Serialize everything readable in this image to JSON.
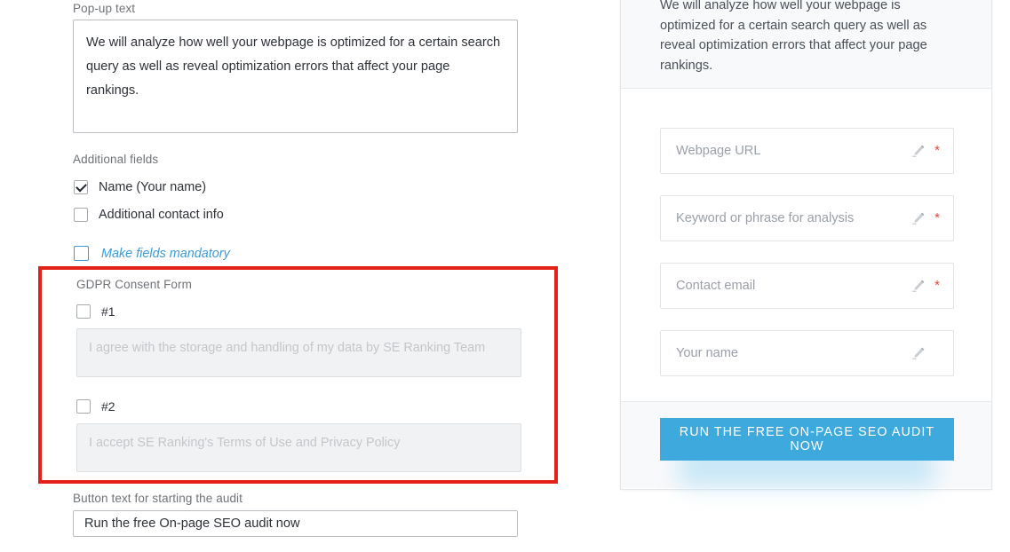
{
  "editor": {
    "popup_text": {
      "label": "Pop-up text",
      "value": "We will analyze how well your webpage is optimized for a certain search query as well as reveal optimization errors that affect your page rankings."
    },
    "additional_fields": {
      "label": "Additional fields",
      "items": [
        {
          "label": "Name (Your name)",
          "checked": true
        },
        {
          "label": "Additional contact info",
          "checked": false
        }
      ],
      "mandatory_toggle": {
        "label": "Make fields mandatory",
        "checked": false
      }
    },
    "gdpr": {
      "label": "GDPR Consent Form",
      "highlight_color": "#e32119",
      "consents": [
        {
          "number": "#1",
          "checked": false,
          "text": "I agree with the storage and handling of my data by SE Ranking Team"
        },
        {
          "number": "#2",
          "checked": false,
          "text": "I accept SE Ranking's Terms of Use and Privacy Policy"
        }
      ]
    },
    "button_text": {
      "label": "Button text for starting the audit",
      "value": "Run the free On-page SEO audit now"
    }
  },
  "preview": {
    "description": "We will analyze how well your webpage is optimized for a certain search query as well as reveal optimization errors that affect your page rankings.",
    "fields": [
      {
        "placeholder": "Webpage URL",
        "required": true,
        "icon": "pencil-icon",
        "required_marker": "*"
      },
      {
        "placeholder": "Keyword or phrase for analysis",
        "required": true,
        "icon": "pencil-icon",
        "required_marker": "*"
      },
      {
        "placeholder": "Contact email",
        "required": true,
        "icon": "pencil-icon",
        "required_marker": "*"
      },
      {
        "placeholder": "Your name",
        "required": false,
        "icon": "pencil-icon",
        "required_marker": "*"
      }
    ],
    "cta": {
      "label": "Run the free On-page SEO audit now",
      "color": "#3da9dd",
      "text_color": "#ffffff"
    }
  }
}
